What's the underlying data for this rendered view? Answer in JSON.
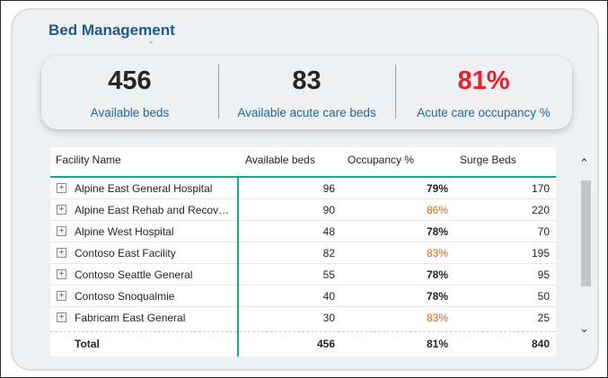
{
  "title": "Bed Management",
  "kpis": [
    {
      "value": "456",
      "label": "Available beds"
    },
    {
      "value": "83",
      "label": "Available acute care beds"
    },
    {
      "value": "81%",
      "label": "Acute care occupancy %"
    }
  ],
  "colors": {
    "accent": "#1f5a8e",
    "warn": "#e0651e",
    "alert": "#e8202a",
    "divider": "#1aa39c"
  },
  "table": {
    "columns": [
      "Facility Name",
      "Available beds",
      "Occupancy %",
      "Surge Beds"
    ],
    "rows": [
      {
        "name": "Alpine East General Hospital",
        "available": "96",
        "occupancy": "79%",
        "surge": "170"
      },
      {
        "name": "Alpine East Rehab and Recov…",
        "available": "90",
        "occupancy": "86%",
        "surge": "220"
      },
      {
        "name": "Alpine West Hospital",
        "available": "48",
        "occupancy": "78%",
        "surge": "70"
      },
      {
        "name": "Contoso East Facility",
        "available": "82",
        "occupancy": "83%",
        "surge": "195"
      },
      {
        "name": "Contoso Seattle General",
        "available": "55",
        "occupancy": "78%",
        "surge": "95"
      },
      {
        "name": "Contoso Snoqualmie",
        "available": "40",
        "occupancy": "78%",
        "surge": "50"
      },
      {
        "name": "Fabricam East General",
        "available": "30",
        "occupancy": "83%",
        "surge": "25"
      }
    ],
    "total": {
      "label": "Total",
      "available": "456",
      "occupancy": "81%",
      "surge": "840"
    }
  },
  "icons": {
    "expand": "plus-square-icon",
    "scroll_up": "chevron-up-icon",
    "scroll_down": "chevron-down-icon"
  }
}
